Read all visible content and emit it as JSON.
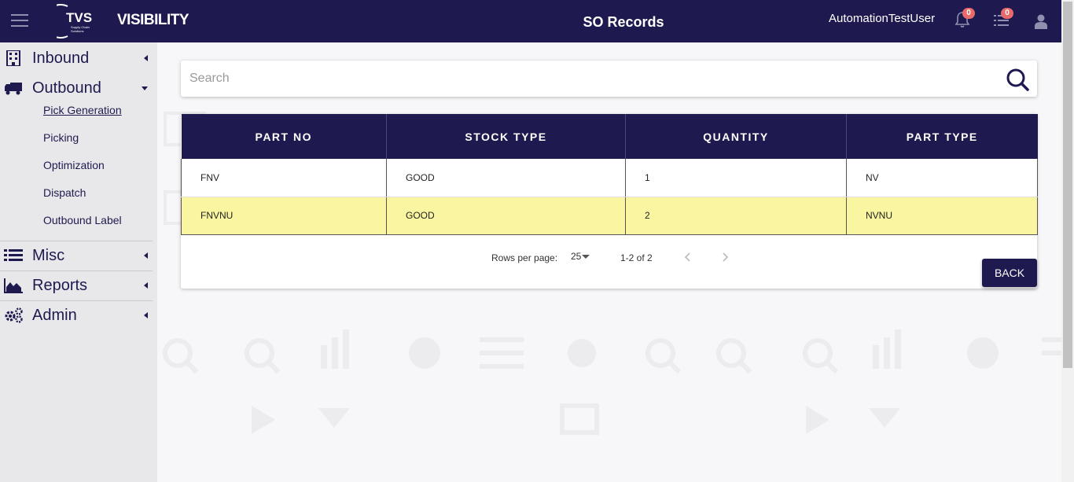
{
  "header": {
    "logo_text": "TVS",
    "logo_subtext": "Supply Chain Solutions",
    "brand": "VISIBILITY",
    "title": "SO Records",
    "username": "AutomationTestUser",
    "notifications_count": "0",
    "tasks_count": "0"
  },
  "sidebar": {
    "items": [
      {
        "label": "Inbound",
        "icon": "building-icon",
        "expanded": false
      },
      {
        "label": "Outbound",
        "icon": "truck-icon",
        "expanded": true,
        "children": [
          "Pick Generation",
          "Picking",
          "Optimization",
          "Dispatch",
          "Outbound Label"
        ],
        "active_child": "Pick Generation"
      },
      {
        "label": "Misc",
        "icon": "list-icon",
        "expanded": false
      },
      {
        "label": "Reports",
        "icon": "area-chart-icon",
        "expanded": false
      },
      {
        "label": "Admin",
        "icon": "gears-icon",
        "expanded": false
      }
    ]
  },
  "search": {
    "placeholder": "Search",
    "value": ""
  },
  "table": {
    "columns": [
      "PART NO",
      "STOCK TYPE",
      "QUANTITY",
      "PART TYPE"
    ],
    "rows": [
      [
        "FNV",
        "GOOD",
        "1",
        "NV"
      ],
      [
        "FNVNU",
        "GOOD",
        "2",
        "NVNU"
      ]
    ],
    "highlight_row": 1
  },
  "pagination": {
    "rows_per_page_label": "Rows per page:",
    "rows_per_page": "25",
    "range": "1-2 of 2"
  },
  "actions": {
    "back_label": "BACK"
  },
  "colors": {
    "primary": "#1e1a4f",
    "highlight": "#faf5a0",
    "badge": "#e86a6a"
  }
}
